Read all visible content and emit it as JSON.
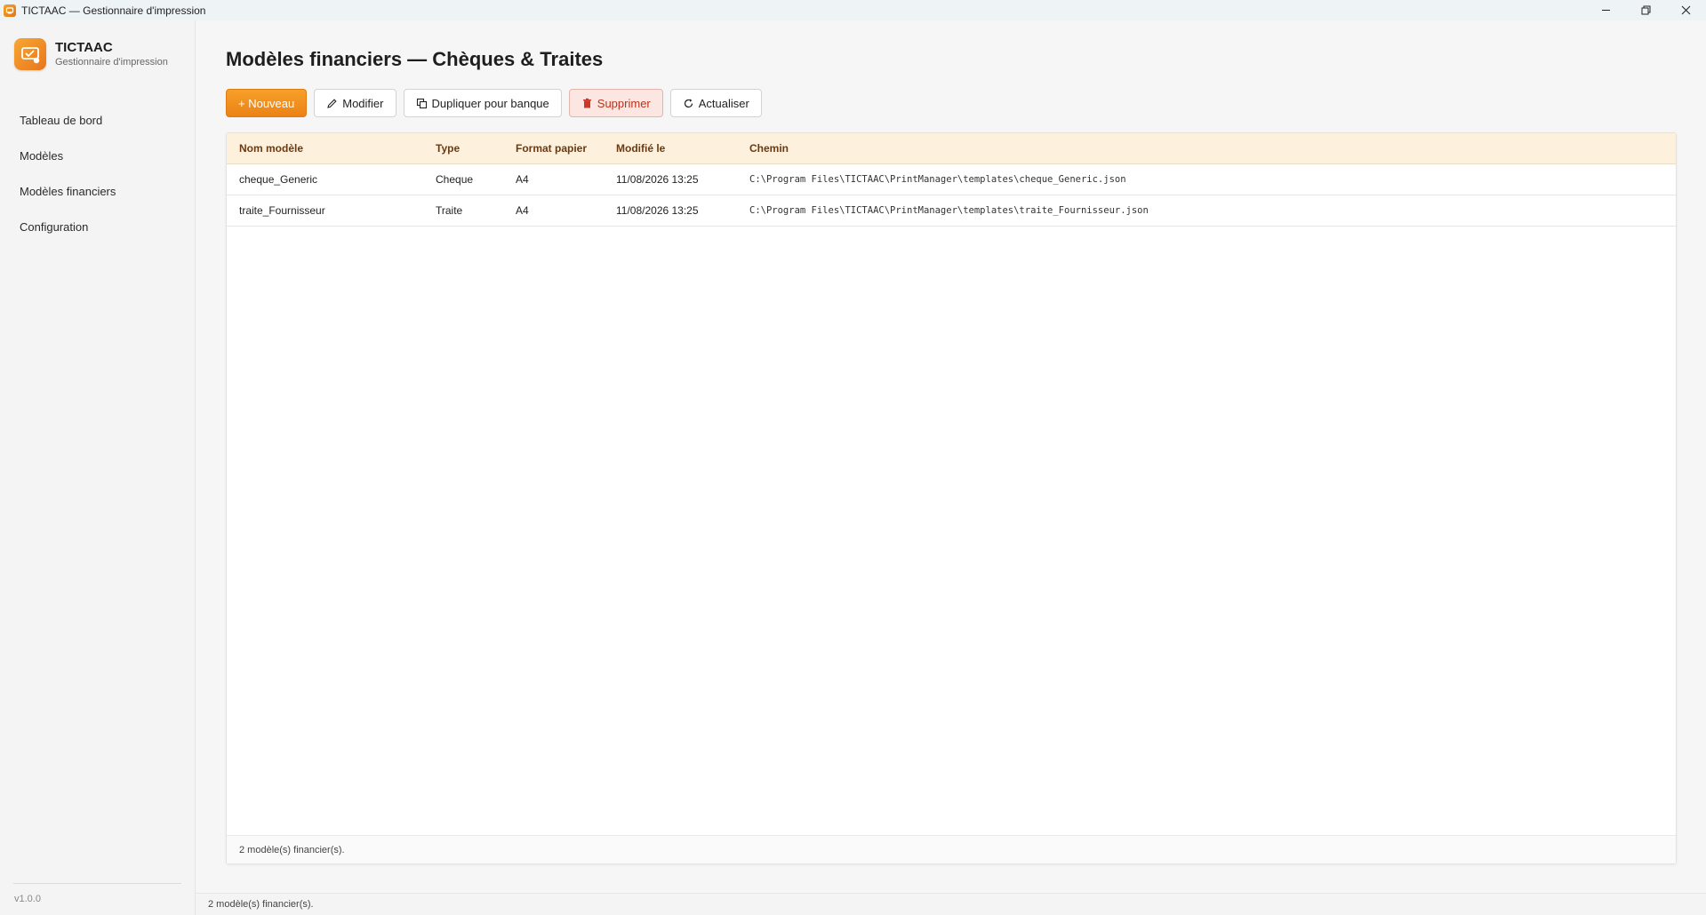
{
  "window": {
    "title": "TICTAAC — Gestionnaire d'impression",
    "icon": "printer-app-icon",
    "controls": [
      "minimize-icon",
      "restore-icon",
      "close-icon"
    ]
  },
  "brand": {
    "name": "TICTAAC",
    "subtitle": "Gestionnaire d'impression",
    "accent": "#f08a1e"
  },
  "sidebar": {
    "items": [
      {
        "label": "Tableau de bord"
      },
      {
        "label": "Modèles"
      },
      {
        "label": "Modèles financiers"
      },
      {
        "label": "Configuration"
      }
    ],
    "version": "v1.0.0"
  },
  "page": {
    "title": "Modèles financiers — Chèques & Traites"
  },
  "toolbar": {
    "new_label": "+ Nouveau",
    "edit_label": "Modifier",
    "duplicate_label": "Dupliquer pour banque",
    "delete_label": "Supprimer",
    "refresh_label": "Actualiser"
  },
  "table": {
    "columns": [
      "Nom modèle",
      "Type",
      "Format papier",
      "Modifié le",
      "Chemin"
    ],
    "rows": [
      {
        "name": "cheque_Generic",
        "type": "Cheque",
        "paper": "A4",
        "modified": "11/08/2026 13:25",
        "path": "C:\\Program Files\\TICTAAC\\PrintManager\\templates\\cheque_Generic.json"
      },
      {
        "name": "traite_Fournisseur",
        "type": "Traite",
        "paper": "A4",
        "modified": "11/08/2026 13:25",
        "path": "C:\\Program Files\\TICTAAC\\PrintManager\\templates\\traite_Fournisseur.json"
      }
    ],
    "footer": "2 modèle(s) financier(s)."
  },
  "statusbar": {
    "text": "2 modèle(s) financier(s)."
  },
  "colors": {
    "primary": "#ec8217",
    "header_bg": "#fdf0dc",
    "danger_bg": "#fbe6e2",
    "danger_text": "#b8321f"
  }
}
